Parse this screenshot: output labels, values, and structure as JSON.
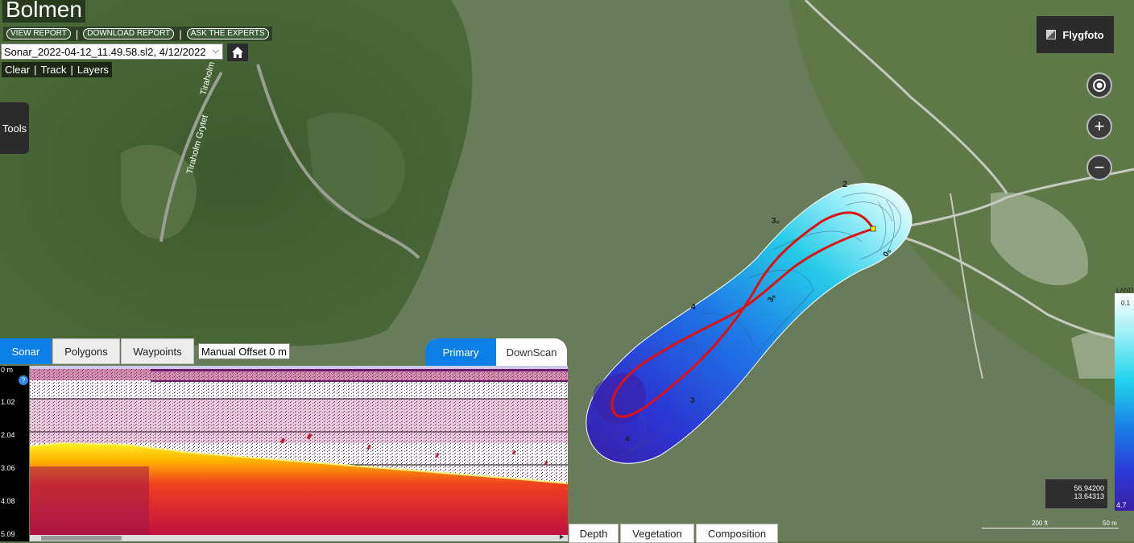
{
  "app": {
    "title": "Bolmen"
  },
  "links": {
    "view_report": "VIEW REPORT",
    "download_report": "DOWNLOAD REPORT",
    "ask_experts": "ASK THE EXPERTS",
    "separator": "|"
  },
  "file_select": {
    "value": "Sonar_2022-04-12_11.49.58.sl2, 4/12/2022"
  },
  "toolbar": {
    "clear": "Clear",
    "track": "Track",
    "layers": "Layers",
    "separator": "|"
  },
  "tools_tab": {
    "label": "Tools"
  },
  "map": {
    "road_labels": [
      "Tiraholm",
      "Tiraholm Grytet"
    ],
    "contour_labels": [
      "2",
      "3₀",
      "0₅",
      "4",
      "3₅",
      "3",
      "4"
    ],
    "basemap_button": "Flygfoto",
    "legend": {
      "top_label": "LAND",
      "max_value": "0.1",
      "min_value": "4.7"
    },
    "coords": {
      "lat": "56.94200",
      "lon": "13.64313"
    },
    "scale": {
      "feet": "200 ft",
      "meters": "50 m"
    },
    "colors": {
      "track": "#e01010",
      "shallow": "#9ef0f8",
      "deep": "#3a1fa8"
    }
  },
  "controls": {
    "locate_icon": "locate-icon",
    "zoom_in": "+",
    "zoom_out": "−"
  },
  "sonar": {
    "tabs": [
      "Sonar",
      "Polygons",
      "Waypoints"
    ],
    "active_tab": "Sonar",
    "manual_offset": "Manual Offset 0 m",
    "view_modes": [
      "Primary",
      "DownScan"
    ],
    "active_view": "Primary",
    "depth_ticks": [
      "0 m",
      "1.02",
      "2.04",
      "3.06",
      "4.08",
      "5.09"
    ],
    "help": "?"
  },
  "bottom_tabs": [
    "Depth",
    "Vegetation",
    "Composition"
  ]
}
